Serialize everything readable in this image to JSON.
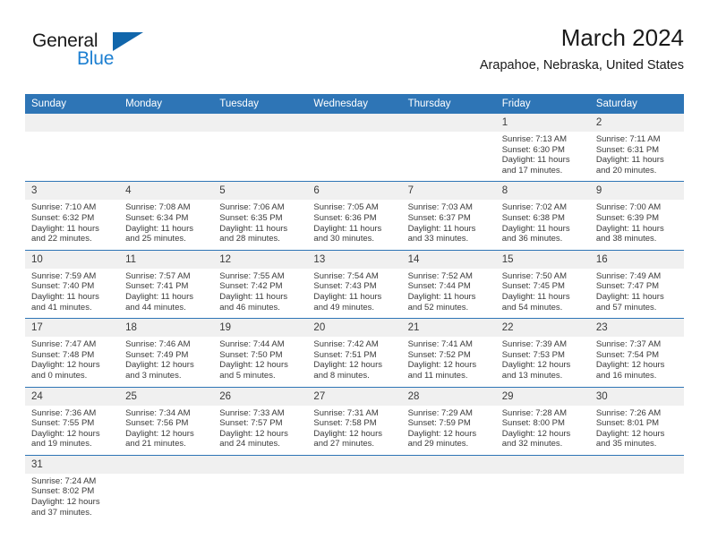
{
  "brand": {
    "name_part1": "General",
    "name_part2": "Blue",
    "flag_icon": "triangle-flag-icon",
    "accent_color": "#1c7fd1"
  },
  "header": {
    "month_title": "March 2024",
    "location": "Arapahoe, Nebraska, United States"
  },
  "theme": {
    "header_bar_color": "#2e75b6",
    "daynum_bg_color": "#f0f0f0",
    "row_separator_color": "#2e75b6",
    "text_color": "#3a3a3a"
  },
  "calendar": {
    "weekday_headers": [
      "Sunday",
      "Monday",
      "Tuesday",
      "Wednesday",
      "Thursday",
      "Friday",
      "Saturday"
    ],
    "weeks": [
      [
        {
          "day": "",
          "sunrise": "",
          "sunset": "",
          "daylight_line1": "",
          "daylight_line2": ""
        },
        {
          "day": "",
          "sunrise": "",
          "sunset": "",
          "daylight_line1": "",
          "daylight_line2": ""
        },
        {
          "day": "",
          "sunrise": "",
          "sunset": "",
          "daylight_line1": "",
          "daylight_line2": ""
        },
        {
          "day": "",
          "sunrise": "",
          "sunset": "",
          "daylight_line1": "",
          "daylight_line2": ""
        },
        {
          "day": "",
          "sunrise": "",
          "sunset": "",
          "daylight_line1": "",
          "daylight_line2": ""
        },
        {
          "day": "1",
          "sunrise": "Sunrise: 7:13 AM",
          "sunset": "Sunset: 6:30 PM",
          "daylight_line1": "Daylight: 11 hours",
          "daylight_line2": "and 17 minutes."
        },
        {
          "day": "2",
          "sunrise": "Sunrise: 7:11 AM",
          "sunset": "Sunset: 6:31 PM",
          "daylight_line1": "Daylight: 11 hours",
          "daylight_line2": "and 20 minutes."
        }
      ],
      [
        {
          "day": "3",
          "sunrise": "Sunrise: 7:10 AM",
          "sunset": "Sunset: 6:32 PM",
          "daylight_line1": "Daylight: 11 hours",
          "daylight_line2": "and 22 minutes."
        },
        {
          "day": "4",
          "sunrise": "Sunrise: 7:08 AM",
          "sunset": "Sunset: 6:34 PM",
          "daylight_line1": "Daylight: 11 hours",
          "daylight_line2": "and 25 minutes."
        },
        {
          "day": "5",
          "sunrise": "Sunrise: 7:06 AM",
          "sunset": "Sunset: 6:35 PM",
          "daylight_line1": "Daylight: 11 hours",
          "daylight_line2": "and 28 minutes."
        },
        {
          "day": "6",
          "sunrise": "Sunrise: 7:05 AM",
          "sunset": "Sunset: 6:36 PM",
          "daylight_line1": "Daylight: 11 hours",
          "daylight_line2": "and 30 minutes."
        },
        {
          "day": "7",
          "sunrise": "Sunrise: 7:03 AM",
          "sunset": "Sunset: 6:37 PM",
          "daylight_line1": "Daylight: 11 hours",
          "daylight_line2": "and 33 minutes."
        },
        {
          "day": "8",
          "sunrise": "Sunrise: 7:02 AM",
          "sunset": "Sunset: 6:38 PM",
          "daylight_line1": "Daylight: 11 hours",
          "daylight_line2": "and 36 minutes."
        },
        {
          "day": "9",
          "sunrise": "Sunrise: 7:00 AM",
          "sunset": "Sunset: 6:39 PM",
          "daylight_line1": "Daylight: 11 hours",
          "daylight_line2": "and 38 minutes."
        }
      ],
      [
        {
          "day": "10",
          "sunrise": "Sunrise: 7:59 AM",
          "sunset": "Sunset: 7:40 PM",
          "daylight_line1": "Daylight: 11 hours",
          "daylight_line2": "and 41 minutes."
        },
        {
          "day": "11",
          "sunrise": "Sunrise: 7:57 AM",
          "sunset": "Sunset: 7:41 PM",
          "daylight_line1": "Daylight: 11 hours",
          "daylight_line2": "and 44 minutes."
        },
        {
          "day": "12",
          "sunrise": "Sunrise: 7:55 AM",
          "sunset": "Sunset: 7:42 PM",
          "daylight_line1": "Daylight: 11 hours",
          "daylight_line2": "and 46 minutes."
        },
        {
          "day": "13",
          "sunrise": "Sunrise: 7:54 AM",
          "sunset": "Sunset: 7:43 PM",
          "daylight_line1": "Daylight: 11 hours",
          "daylight_line2": "and 49 minutes."
        },
        {
          "day": "14",
          "sunrise": "Sunrise: 7:52 AM",
          "sunset": "Sunset: 7:44 PM",
          "daylight_line1": "Daylight: 11 hours",
          "daylight_line2": "and 52 minutes."
        },
        {
          "day": "15",
          "sunrise": "Sunrise: 7:50 AM",
          "sunset": "Sunset: 7:45 PM",
          "daylight_line1": "Daylight: 11 hours",
          "daylight_line2": "and 54 minutes."
        },
        {
          "day": "16",
          "sunrise": "Sunrise: 7:49 AM",
          "sunset": "Sunset: 7:47 PM",
          "daylight_line1": "Daylight: 11 hours",
          "daylight_line2": "and 57 minutes."
        }
      ],
      [
        {
          "day": "17",
          "sunrise": "Sunrise: 7:47 AM",
          "sunset": "Sunset: 7:48 PM",
          "daylight_line1": "Daylight: 12 hours",
          "daylight_line2": "and 0 minutes."
        },
        {
          "day": "18",
          "sunrise": "Sunrise: 7:46 AM",
          "sunset": "Sunset: 7:49 PM",
          "daylight_line1": "Daylight: 12 hours",
          "daylight_line2": "and 3 minutes."
        },
        {
          "day": "19",
          "sunrise": "Sunrise: 7:44 AM",
          "sunset": "Sunset: 7:50 PM",
          "daylight_line1": "Daylight: 12 hours",
          "daylight_line2": "and 5 minutes."
        },
        {
          "day": "20",
          "sunrise": "Sunrise: 7:42 AM",
          "sunset": "Sunset: 7:51 PM",
          "daylight_line1": "Daylight: 12 hours",
          "daylight_line2": "and 8 minutes."
        },
        {
          "day": "21",
          "sunrise": "Sunrise: 7:41 AM",
          "sunset": "Sunset: 7:52 PM",
          "daylight_line1": "Daylight: 12 hours",
          "daylight_line2": "and 11 minutes."
        },
        {
          "day": "22",
          "sunrise": "Sunrise: 7:39 AM",
          "sunset": "Sunset: 7:53 PM",
          "daylight_line1": "Daylight: 12 hours",
          "daylight_line2": "and 13 minutes."
        },
        {
          "day": "23",
          "sunrise": "Sunrise: 7:37 AM",
          "sunset": "Sunset: 7:54 PM",
          "daylight_line1": "Daylight: 12 hours",
          "daylight_line2": "and 16 minutes."
        }
      ],
      [
        {
          "day": "24",
          "sunrise": "Sunrise: 7:36 AM",
          "sunset": "Sunset: 7:55 PM",
          "daylight_line1": "Daylight: 12 hours",
          "daylight_line2": "and 19 minutes."
        },
        {
          "day": "25",
          "sunrise": "Sunrise: 7:34 AM",
          "sunset": "Sunset: 7:56 PM",
          "daylight_line1": "Daylight: 12 hours",
          "daylight_line2": "and 21 minutes."
        },
        {
          "day": "26",
          "sunrise": "Sunrise: 7:33 AM",
          "sunset": "Sunset: 7:57 PM",
          "daylight_line1": "Daylight: 12 hours",
          "daylight_line2": "and 24 minutes."
        },
        {
          "day": "27",
          "sunrise": "Sunrise: 7:31 AM",
          "sunset": "Sunset: 7:58 PM",
          "daylight_line1": "Daylight: 12 hours",
          "daylight_line2": "and 27 minutes."
        },
        {
          "day": "28",
          "sunrise": "Sunrise: 7:29 AM",
          "sunset": "Sunset: 7:59 PM",
          "daylight_line1": "Daylight: 12 hours",
          "daylight_line2": "and 29 minutes."
        },
        {
          "day": "29",
          "sunrise": "Sunrise: 7:28 AM",
          "sunset": "Sunset: 8:00 PM",
          "daylight_line1": "Daylight: 12 hours",
          "daylight_line2": "and 32 minutes."
        },
        {
          "day": "30",
          "sunrise": "Sunrise: 7:26 AM",
          "sunset": "Sunset: 8:01 PM",
          "daylight_line1": "Daylight: 12 hours",
          "daylight_line2": "and 35 minutes."
        }
      ],
      [
        {
          "day": "31",
          "sunrise": "Sunrise: 7:24 AM",
          "sunset": "Sunset: 8:02 PM",
          "daylight_line1": "Daylight: 12 hours",
          "daylight_line2": "and 37 minutes."
        },
        {
          "day": "",
          "sunrise": "",
          "sunset": "",
          "daylight_line1": "",
          "daylight_line2": ""
        },
        {
          "day": "",
          "sunrise": "",
          "sunset": "",
          "daylight_line1": "",
          "daylight_line2": ""
        },
        {
          "day": "",
          "sunrise": "",
          "sunset": "",
          "daylight_line1": "",
          "daylight_line2": ""
        },
        {
          "day": "",
          "sunrise": "",
          "sunset": "",
          "daylight_line1": "",
          "daylight_line2": ""
        },
        {
          "day": "",
          "sunrise": "",
          "sunset": "",
          "daylight_line1": "",
          "daylight_line2": ""
        },
        {
          "day": "",
          "sunrise": "",
          "sunset": "",
          "daylight_line1": "",
          "daylight_line2": ""
        }
      ]
    ]
  }
}
